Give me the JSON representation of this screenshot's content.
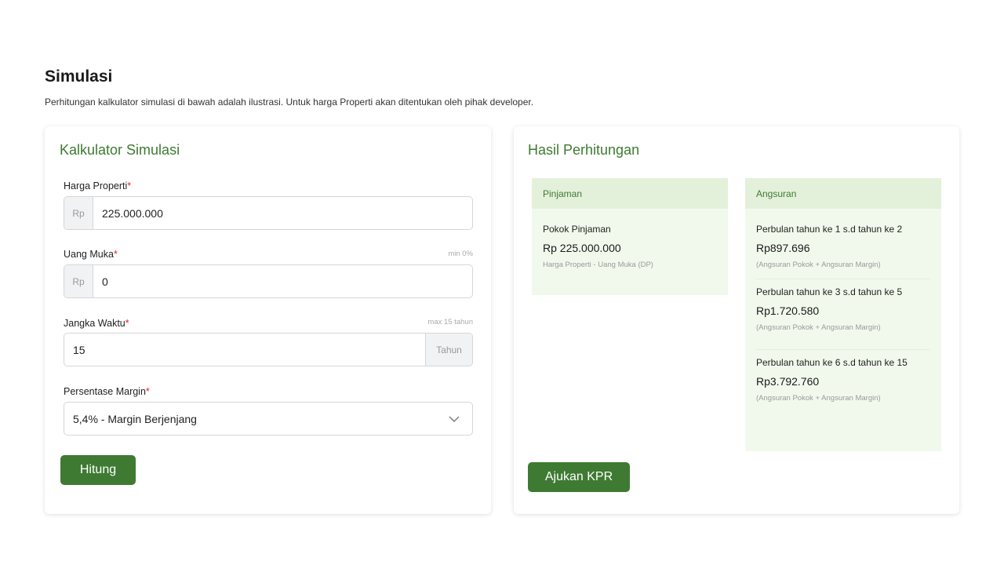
{
  "header": {
    "title": "Simulasi",
    "subtitle": "Perhitungan kalkulator simulasi di bawah adalah ilustrasi. Untuk harga Properti akan ditentukan oleh pihak developer."
  },
  "calculator": {
    "title": "Kalkulator Simulasi",
    "required_mark": "*",
    "harga": {
      "label": "Harga Properti",
      "prefix": "Rp",
      "value": "225.000.000"
    },
    "uang_muka": {
      "label": "Uang Muka",
      "hint": "min 0%",
      "prefix": "Rp",
      "value": "0"
    },
    "jangka": {
      "label": "Jangka Waktu",
      "hint": "max 15 tahun",
      "value": "15",
      "suffix": "Tahun"
    },
    "margin": {
      "label": "Persentase Margin",
      "selected": "5,4% - Margin Berjenjang",
      "icon": "chevron-down-icon"
    },
    "submit_label": "Hitung"
  },
  "result": {
    "title": "Hasil Perhitungan",
    "pinjaman": {
      "header": "Pinjaman",
      "label": "Pokok Pinjaman",
      "value": "Rp 225.000.000",
      "note": "Harga Properti - Uang Muka (DP)"
    },
    "angsuran": {
      "header": "Angsuran",
      "items": [
        {
          "label": "Perbulan tahun ke 1 s.d tahun ke 2",
          "value": "Rp897.696",
          "note": "(Angsuran Pokok + Angsuran Margin)"
        },
        {
          "label": "Perbulan tahun ke 3 s.d tahun ke 5",
          "value": "Rp1.720.580",
          "note": "(Angsuran Pokok + Angsuran Margin)"
        },
        {
          "label": "Perbulan tahun ke 6 s.d tahun ke 15",
          "value": "Rp3.792.760",
          "note": "(Angsuran Pokok + Angsuran Margin)"
        }
      ]
    },
    "apply_label": "Ajukan KPR"
  },
  "colors": {
    "brand": "#3e7a32",
    "panel_bg": "#f1f9ec",
    "panel_head": "#e3f1db",
    "required": "#e0222a"
  }
}
